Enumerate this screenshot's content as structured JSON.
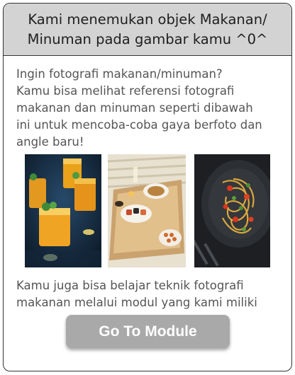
{
  "header": {
    "title": "Kami menemukan objek Makanan/\nMinuman pada gambar kamu ^0^"
  },
  "body": {
    "intro": "Ingin fotografi makanan/minuman?\nKamu bisa melihat referensi fotografi\nmakanan dan minuman seperti dibawah\nini untuk mencoba-coba gaya berfoto dan\nangle baru!",
    "outro": "Kamu juga bisa belajar teknik fotografi\nmakanan melalui modul yang kami miliki"
  },
  "gallery": [
    {
      "icon": "drinks-photo"
    },
    {
      "icon": "breakfast-tray-photo"
    },
    {
      "icon": "pasta-plate-photo"
    }
  ],
  "actions": {
    "go_to_module_label": "Go To Module"
  },
  "colors": {
    "header_bg": "#d3d3d3",
    "button_bg": "#a9a9a9",
    "text": "#555555"
  }
}
